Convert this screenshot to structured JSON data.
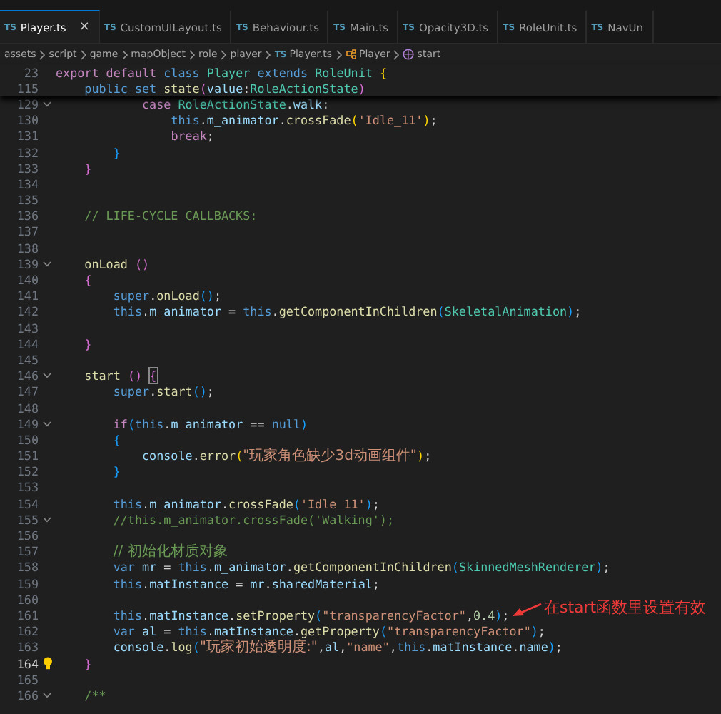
{
  "tabs": [
    {
      "icon": "TS",
      "label": "Player.ts",
      "selected": true,
      "close": "×"
    },
    {
      "icon": "TS",
      "label": "CustomUILayout.ts",
      "selected": false
    },
    {
      "icon": "TS",
      "label": "Behaviour.ts",
      "selected": false
    },
    {
      "icon": "TS",
      "label": "Main.ts",
      "selected": false
    },
    {
      "icon": "TS",
      "label": "Opacity3D.ts",
      "selected": false
    },
    {
      "icon": "TS",
      "label": "RoleUnit.ts",
      "selected": false
    },
    {
      "icon": "TS",
      "label": "NavUn",
      "selected": false
    }
  ],
  "breadcrumb": [
    {
      "kind": "folder",
      "label": "assets"
    },
    {
      "kind": "folder",
      "label": "script"
    },
    {
      "kind": "folder",
      "label": "game"
    },
    {
      "kind": "folder",
      "label": "mapObject"
    },
    {
      "kind": "folder",
      "label": "role"
    },
    {
      "kind": "folder",
      "label": "player"
    },
    {
      "kind": "file",
      "icon": "TS",
      "label": "Player.ts"
    },
    {
      "kind": "class",
      "label": "Player"
    },
    {
      "kind": "method",
      "label": "start"
    }
  ],
  "sticky_lines": [
    {
      "number": "23",
      "tokens": [
        {
          "t": "export default",
          "kind": "kw"
        },
        {
          "t": " class",
          "kind": "st"
        },
        {
          "t": " Player",
          "kind": "cls"
        },
        {
          "t": " extends",
          "kind": "st"
        },
        {
          "t": " RoleUnit",
          "kind": "cls"
        },
        {
          "t": " {",
          "kind": "b1"
        }
      ]
    },
    {
      "number": "115",
      "tokens": [
        {
          "t": "    public set",
          "kind": "st"
        },
        {
          "t": " state",
          "kind": "fn"
        },
        {
          "t": "(",
          "kind": "b2"
        },
        {
          "t": "value",
          "kind": "var"
        },
        {
          "t": ":",
          "kind": "p"
        },
        {
          "t": "RoleActionState",
          "kind": "cls"
        },
        {
          "t": ")",
          "kind": "b2"
        }
      ]
    }
  ],
  "lines": [
    {
      "number": "129",
      "foldable": true,
      "current": false,
      "lightbulb": false,
      "tokens": [
        {
          "t": "            case",
          "kind": "kw"
        },
        {
          "t": " RoleActionState",
          "kind": "cls"
        },
        {
          "t": ".",
          "kind": "p"
        },
        {
          "t": "walk",
          "kind": "var"
        },
        {
          "t": ":",
          "kind": "p"
        }
      ]
    },
    {
      "number": "130",
      "foldable": false,
      "current": false,
      "lightbulb": false,
      "tokens": [
        {
          "t": "                this",
          "kind": "st"
        },
        {
          "t": ".",
          "kind": "p"
        },
        {
          "t": "m_animator",
          "kind": "var"
        },
        {
          "t": ".",
          "kind": "p"
        },
        {
          "t": "crossFade",
          "kind": "fn"
        },
        {
          "t": "(",
          "kind": "b1"
        },
        {
          "t": "'Idle_11'",
          "kind": "str"
        },
        {
          "t": ")",
          "kind": "b1"
        },
        {
          "t": ";",
          "kind": "p"
        }
      ]
    },
    {
      "number": "131",
      "foldable": false,
      "current": false,
      "lightbulb": false,
      "tokens": [
        {
          "t": "                break",
          "kind": "kw"
        },
        {
          "t": ";",
          "kind": "p"
        }
      ]
    },
    {
      "number": "132",
      "foldable": false,
      "current": false,
      "lightbulb": false,
      "tokens": [
        {
          "t": "        }",
          "kind": "b3"
        }
      ]
    },
    {
      "number": "133",
      "foldable": false,
      "current": false,
      "lightbulb": false,
      "tokens": [
        {
          "t": "    }",
          "kind": "b2"
        }
      ]
    },
    {
      "number": "134",
      "foldable": false,
      "current": false,
      "lightbulb": false
    },
    {
      "number": "135",
      "foldable": false,
      "current": false,
      "lightbulb": false
    },
    {
      "number": "136",
      "foldable": false,
      "current": false,
      "lightbulb": false,
      "tokens": [
        {
          "t": "    // LIFE-CYCLE CALLBACKS:",
          "kind": "cmt"
        }
      ]
    },
    {
      "number": "137",
      "foldable": false,
      "current": false,
      "lightbulb": false
    },
    {
      "number": "138",
      "foldable": false,
      "current": false,
      "lightbulb": false
    },
    {
      "number": "139",
      "foldable": true,
      "current": false,
      "lightbulb": false,
      "tokens": [
        {
          "t": "    onLoad",
          "kind": "fn"
        },
        {
          "t": " ()",
          "kind": "b2"
        }
      ]
    },
    {
      "number": "140",
      "foldable": false,
      "current": false,
      "lightbulb": false,
      "tokens": [
        {
          "t": "    {",
          "kind": "b2"
        }
      ]
    },
    {
      "number": "141",
      "foldable": false,
      "current": false,
      "lightbulb": false,
      "tokens": [
        {
          "t": "        super",
          "kind": "st"
        },
        {
          "t": ".",
          "kind": "p"
        },
        {
          "t": "onLoad",
          "kind": "fn"
        },
        {
          "t": "()",
          "kind": "b3"
        },
        {
          "t": ";",
          "kind": "p"
        }
      ]
    },
    {
      "number": "142",
      "foldable": false,
      "current": false,
      "lightbulb": false,
      "tokens": [
        {
          "t": "        this",
          "kind": "st"
        },
        {
          "t": ".",
          "kind": "p"
        },
        {
          "t": "m_animator",
          "kind": "var"
        },
        {
          "t": " =",
          "kind": "p"
        },
        {
          "t": " this",
          "kind": "st"
        },
        {
          "t": ".",
          "kind": "p"
        },
        {
          "t": "getComponentInChildren",
          "kind": "fn"
        },
        {
          "t": "(",
          "kind": "b3"
        },
        {
          "t": "SkeletalAnimation",
          "kind": "cls"
        },
        {
          "t": ")",
          "kind": "b3"
        },
        {
          "t": ";",
          "kind": "p"
        }
      ]
    },
    {
      "number": "143",
      "foldable": false,
      "current": false,
      "lightbulb": false
    },
    {
      "number": "144",
      "foldable": false,
      "current": false,
      "lightbulb": false,
      "tokens": [
        {
          "t": "    }",
          "kind": "b2"
        }
      ]
    },
    {
      "number": "145",
      "foldable": false,
      "current": false,
      "lightbulb": false
    },
    {
      "number": "146",
      "foldable": true,
      "current": false,
      "lightbulb": false,
      "tokens": [
        {
          "t": "    start",
          "kind": "fn"
        },
        {
          "t": " ()",
          "kind": "b2"
        },
        {
          "t": " {",
          "kind": "b2m"
        }
      ]
    },
    {
      "number": "147",
      "foldable": false,
      "current": false,
      "lightbulb": false,
      "tokens": [
        {
          "t": "        super",
          "kind": "st"
        },
        {
          "t": ".",
          "kind": "p"
        },
        {
          "t": "start",
          "kind": "fn"
        },
        {
          "t": "()",
          "kind": "b3"
        },
        {
          "t": ";",
          "kind": "p"
        }
      ]
    },
    {
      "number": "148",
      "foldable": false,
      "current": false,
      "lightbulb": false
    },
    {
      "number": "149",
      "foldable": true,
      "current": false,
      "lightbulb": false,
      "tokens": [
        {
          "t": "        if",
          "kind": "kw"
        },
        {
          "t": "(",
          "kind": "b3"
        },
        {
          "t": "this",
          "kind": "st"
        },
        {
          "t": ".",
          "kind": "p"
        },
        {
          "t": "m_animator",
          "kind": "var"
        },
        {
          "t": " ==",
          "kind": "p"
        },
        {
          "t": " null",
          "kind": "st"
        },
        {
          "t": ")",
          "kind": "b3"
        }
      ]
    },
    {
      "number": "150",
      "foldable": false,
      "current": false,
      "lightbulb": false,
      "tokens": [
        {
          "t": "        {",
          "kind": "b3"
        }
      ]
    },
    {
      "number": "151",
      "foldable": false,
      "current": false,
      "lightbulb": false,
      "tokens": [
        {
          "t": "            console",
          "kind": "var"
        },
        {
          "t": ".",
          "kind": "p"
        },
        {
          "t": "error",
          "kind": "fn"
        },
        {
          "t": "(",
          "kind": "b1"
        },
        {
          "t": "\"玩家角色缺少3d动画组件\"",
          "kind": "str"
        },
        {
          "t": ")",
          "kind": "b1"
        },
        {
          "t": ";",
          "kind": "p"
        }
      ]
    },
    {
      "number": "152",
      "foldable": false,
      "current": false,
      "lightbulb": false,
      "tokens": [
        {
          "t": "        }",
          "kind": "b3"
        }
      ]
    },
    {
      "number": "153",
      "foldable": false,
      "current": false,
      "lightbulb": false
    },
    {
      "number": "154",
      "foldable": false,
      "current": false,
      "lightbulb": false,
      "tokens": [
        {
          "t": "        this",
          "kind": "st"
        },
        {
          "t": ".",
          "kind": "p"
        },
        {
          "t": "m_animator",
          "kind": "var"
        },
        {
          "t": ".",
          "kind": "p"
        },
        {
          "t": "crossFade",
          "kind": "fn"
        },
        {
          "t": "(",
          "kind": "b3"
        },
        {
          "t": "'Idle_11'",
          "kind": "str"
        },
        {
          "t": ")",
          "kind": "b3"
        },
        {
          "t": ";",
          "kind": "p"
        }
      ]
    },
    {
      "number": "155",
      "foldable": true,
      "current": false,
      "lightbulb": false,
      "tokens": [
        {
          "t": "        //this.m_animator.crossFade('Walking');",
          "kind": "cmt"
        }
      ]
    },
    {
      "number": "156",
      "foldable": false,
      "current": false,
      "lightbulb": false
    },
    {
      "number": "157",
      "foldable": false,
      "current": false,
      "lightbulb": false,
      "tokens": [
        {
          "t": "        // 初始化材质对象",
          "kind": "cmt"
        }
      ]
    },
    {
      "number": "158",
      "foldable": false,
      "current": false,
      "lightbulb": false,
      "tokens": [
        {
          "t": "        var",
          "kind": "st"
        },
        {
          "t": " mr",
          "kind": "var"
        },
        {
          "t": " =",
          "kind": "p"
        },
        {
          "t": " this",
          "kind": "st"
        },
        {
          "t": ".",
          "kind": "p"
        },
        {
          "t": "m_animator",
          "kind": "var"
        },
        {
          "t": ".",
          "kind": "p"
        },
        {
          "t": "getComponentInChildren",
          "kind": "fn"
        },
        {
          "t": "(",
          "kind": "b3"
        },
        {
          "t": "SkinnedMeshRenderer",
          "kind": "cls"
        },
        {
          "t": ")",
          "kind": "b3"
        },
        {
          "t": ";",
          "kind": "p"
        }
      ]
    },
    {
      "number": "159",
      "foldable": false,
      "current": false,
      "lightbulb": false,
      "tokens": [
        {
          "t": "        this",
          "kind": "st"
        },
        {
          "t": ".",
          "kind": "p"
        },
        {
          "t": "matInstance",
          "kind": "var"
        },
        {
          "t": " =",
          "kind": "p"
        },
        {
          "t": " mr",
          "kind": "var"
        },
        {
          "t": ".",
          "kind": "p"
        },
        {
          "t": "sharedMaterial",
          "kind": "var"
        },
        {
          "t": ";",
          "kind": "p"
        }
      ]
    },
    {
      "number": "160",
      "foldable": false,
      "current": false,
      "lightbulb": false
    },
    {
      "number": "161",
      "foldable": false,
      "current": false,
      "lightbulb": false,
      "tokens": [
        {
          "t": "        this",
          "kind": "st"
        },
        {
          "t": ".",
          "kind": "p"
        },
        {
          "t": "matInstance",
          "kind": "var"
        },
        {
          "t": ".",
          "kind": "p"
        },
        {
          "t": "setProperty",
          "kind": "fn"
        },
        {
          "t": "(",
          "kind": "b3"
        },
        {
          "t": "\"transparencyFactor\"",
          "kind": "str"
        },
        {
          "t": ",",
          "kind": "p"
        },
        {
          "t": "0.4",
          "kind": "num"
        },
        {
          "t": ")",
          "kind": "b3"
        },
        {
          "t": ";",
          "kind": "p"
        }
      ]
    },
    {
      "number": "162",
      "foldable": false,
      "current": false,
      "lightbulb": false,
      "tokens": [
        {
          "t": "        var",
          "kind": "st"
        },
        {
          "t": " al",
          "kind": "var"
        },
        {
          "t": " =",
          "kind": "p"
        },
        {
          "t": " this",
          "kind": "st"
        },
        {
          "t": ".",
          "kind": "p"
        },
        {
          "t": "matInstance",
          "kind": "var"
        },
        {
          "t": ".",
          "kind": "p"
        },
        {
          "t": "getProperty",
          "kind": "fn"
        },
        {
          "t": "(",
          "kind": "b3"
        },
        {
          "t": "\"transparencyFactor\"",
          "kind": "str"
        },
        {
          "t": ")",
          "kind": "b3"
        },
        {
          "t": ";",
          "kind": "p"
        }
      ]
    },
    {
      "number": "163",
      "foldable": false,
      "current": false,
      "lightbulb": false,
      "tokens": [
        {
          "t": "        console",
          "kind": "var"
        },
        {
          "t": ".",
          "kind": "p"
        },
        {
          "t": "log",
          "kind": "fn"
        },
        {
          "t": "(",
          "kind": "b3"
        },
        {
          "t": "\"玩家初始透明度:\"",
          "kind": "str"
        },
        {
          "t": ",",
          "kind": "p"
        },
        {
          "t": "al",
          "kind": "var"
        },
        {
          "t": ",",
          "kind": "p"
        },
        {
          "t": "\"name\"",
          "kind": "str"
        },
        {
          "t": ",",
          "kind": "p"
        },
        {
          "t": "this",
          "kind": "st"
        },
        {
          "t": ".",
          "kind": "p"
        },
        {
          "t": "matInstance",
          "kind": "var"
        },
        {
          "t": ".",
          "kind": "p"
        },
        {
          "t": "name",
          "kind": "var"
        },
        {
          "t": ")",
          "kind": "b3"
        },
        {
          "t": ";",
          "kind": "p"
        }
      ]
    },
    {
      "number": "164",
      "foldable": false,
      "current": true,
      "lightbulb": true,
      "tokens": [
        {
          "t": "    }",
          "kind": "b2"
        }
      ]
    },
    {
      "number": "165",
      "foldable": false,
      "current": false,
      "lightbulb": false
    },
    {
      "number": "166",
      "foldable": true,
      "current": false,
      "lightbulb": false,
      "tokens": [
        {
          "t": "    /**",
          "kind": "cmt"
        }
      ]
    }
  ],
  "annotation": {
    "text": "在start函数里设置有效"
  }
}
